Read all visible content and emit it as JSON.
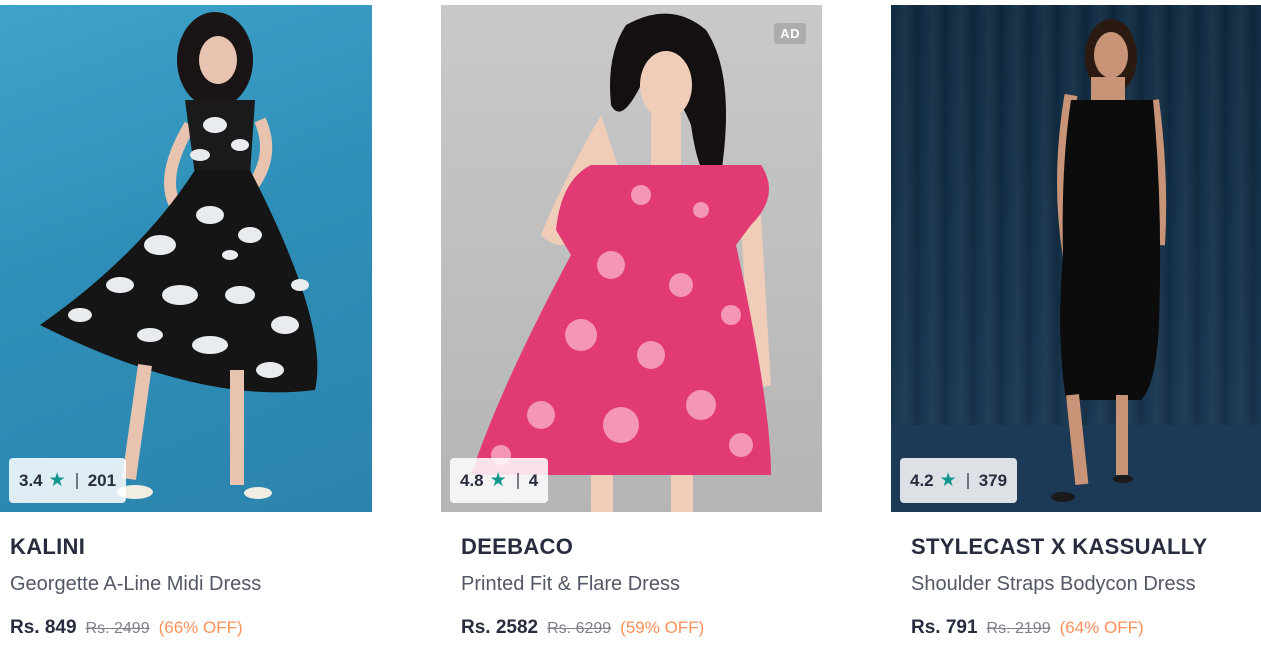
{
  "products": [
    {
      "brand": "KALINI",
      "title": "Georgette A-Line Midi Dress",
      "rating": "3.4",
      "rating_count": "201",
      "price": "Rs. 849",
      "mrp": "Rs. 2499",
      "discount": "(66% OFF)",
      "ad": ""
    },
    {
      "brand": "DEEBACO",
      "title": "Printed Fit & Flare Dress",
      "rating": "4.8",
      "rating_count": "4",
      "price": "Rs. 2582",
      "mrp": "Rs. 6299",
      "discount": "(59% OFF)",
      "ad": "AD"
    },
    {
      "brand": "STYLECAST X KASSUALLY",
      "title": "Shoulder Straps Bodycon Dress",
      "rating": "4.2",
      "rating_count": "379",
      "price": "Rs. 791",
      "mrp": "Rs. 2199",
      "discount": "(64% OFF)",
      "ad": ""
    }
  ],
  "icons": {
    "star": "star-icon"
  },
  "colors": {
    "star": "#14958f",
    "discount": "#ff905a",
    "text": "#282c3f"
  }
}
